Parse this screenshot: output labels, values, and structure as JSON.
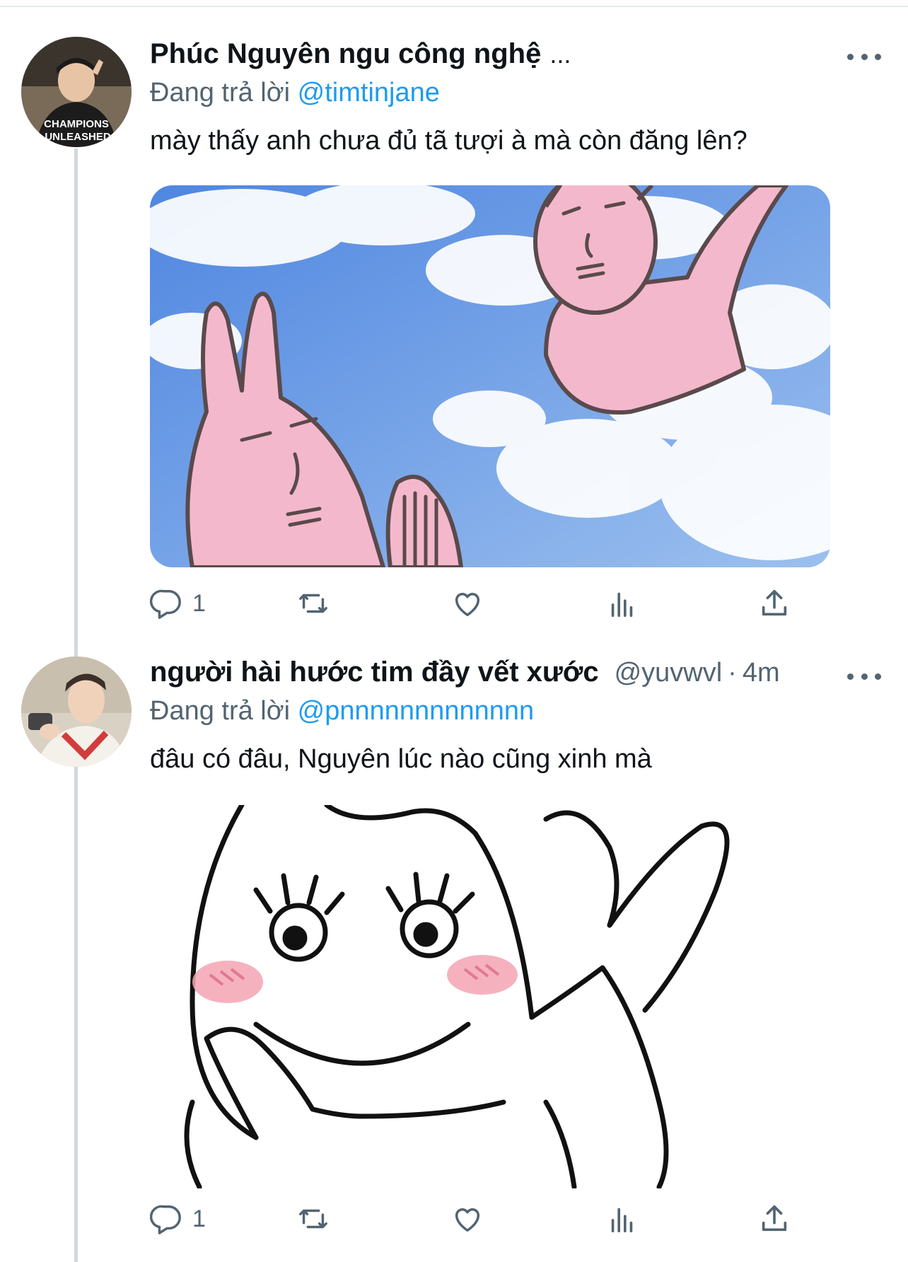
{
  "tweets": [
    {
      "name": "Phúc Nguyên ngu công nghệ",
      "name_ellipsis": "...",
      "reply_prefix": "Đang trả lời",
      "reply_to": "@timtinjane",
      "text": "mày thấy anh chưa đủ tã tượi à mà còn đăng lên?",
      "avatar_shirt_text": [
        "CHAMPIONS",
        "UNLEASHED"
      ],
      "media": "pink bunny characters waving in blue sky with clouds",
      "actions": {
        "reply_count": "1"
      }
    },
    {
      "name": "người hài hước tim đầy vết xước",
      "handle": "@yuvwvl",
      "separator": "·",
      "time": "4m",
      "reply_prefix": "Đang trả lời",
      "reply_to": "@pnnnnnnnnnnnnn",
      "text": "đâu có đâu, Nguyên lúc nào cũng xinh mà",
      "media": "line-art bunny character with blushing cheeks making a heart",
      "actions": {
        "reply_count": "1"
      }
    }
  ],
  "colors": {
    "link": "#1d9bf0",
    "muted": "#536471",
    "text": "#0f1419",
    "thread_line": "#cfd9de"
  },
  "icons": [
    "reply-icon",
    "retweet-icon",
    "like-icon",
    "views-icon",
    "share-icon",
    "more-icon"
  ]
}
